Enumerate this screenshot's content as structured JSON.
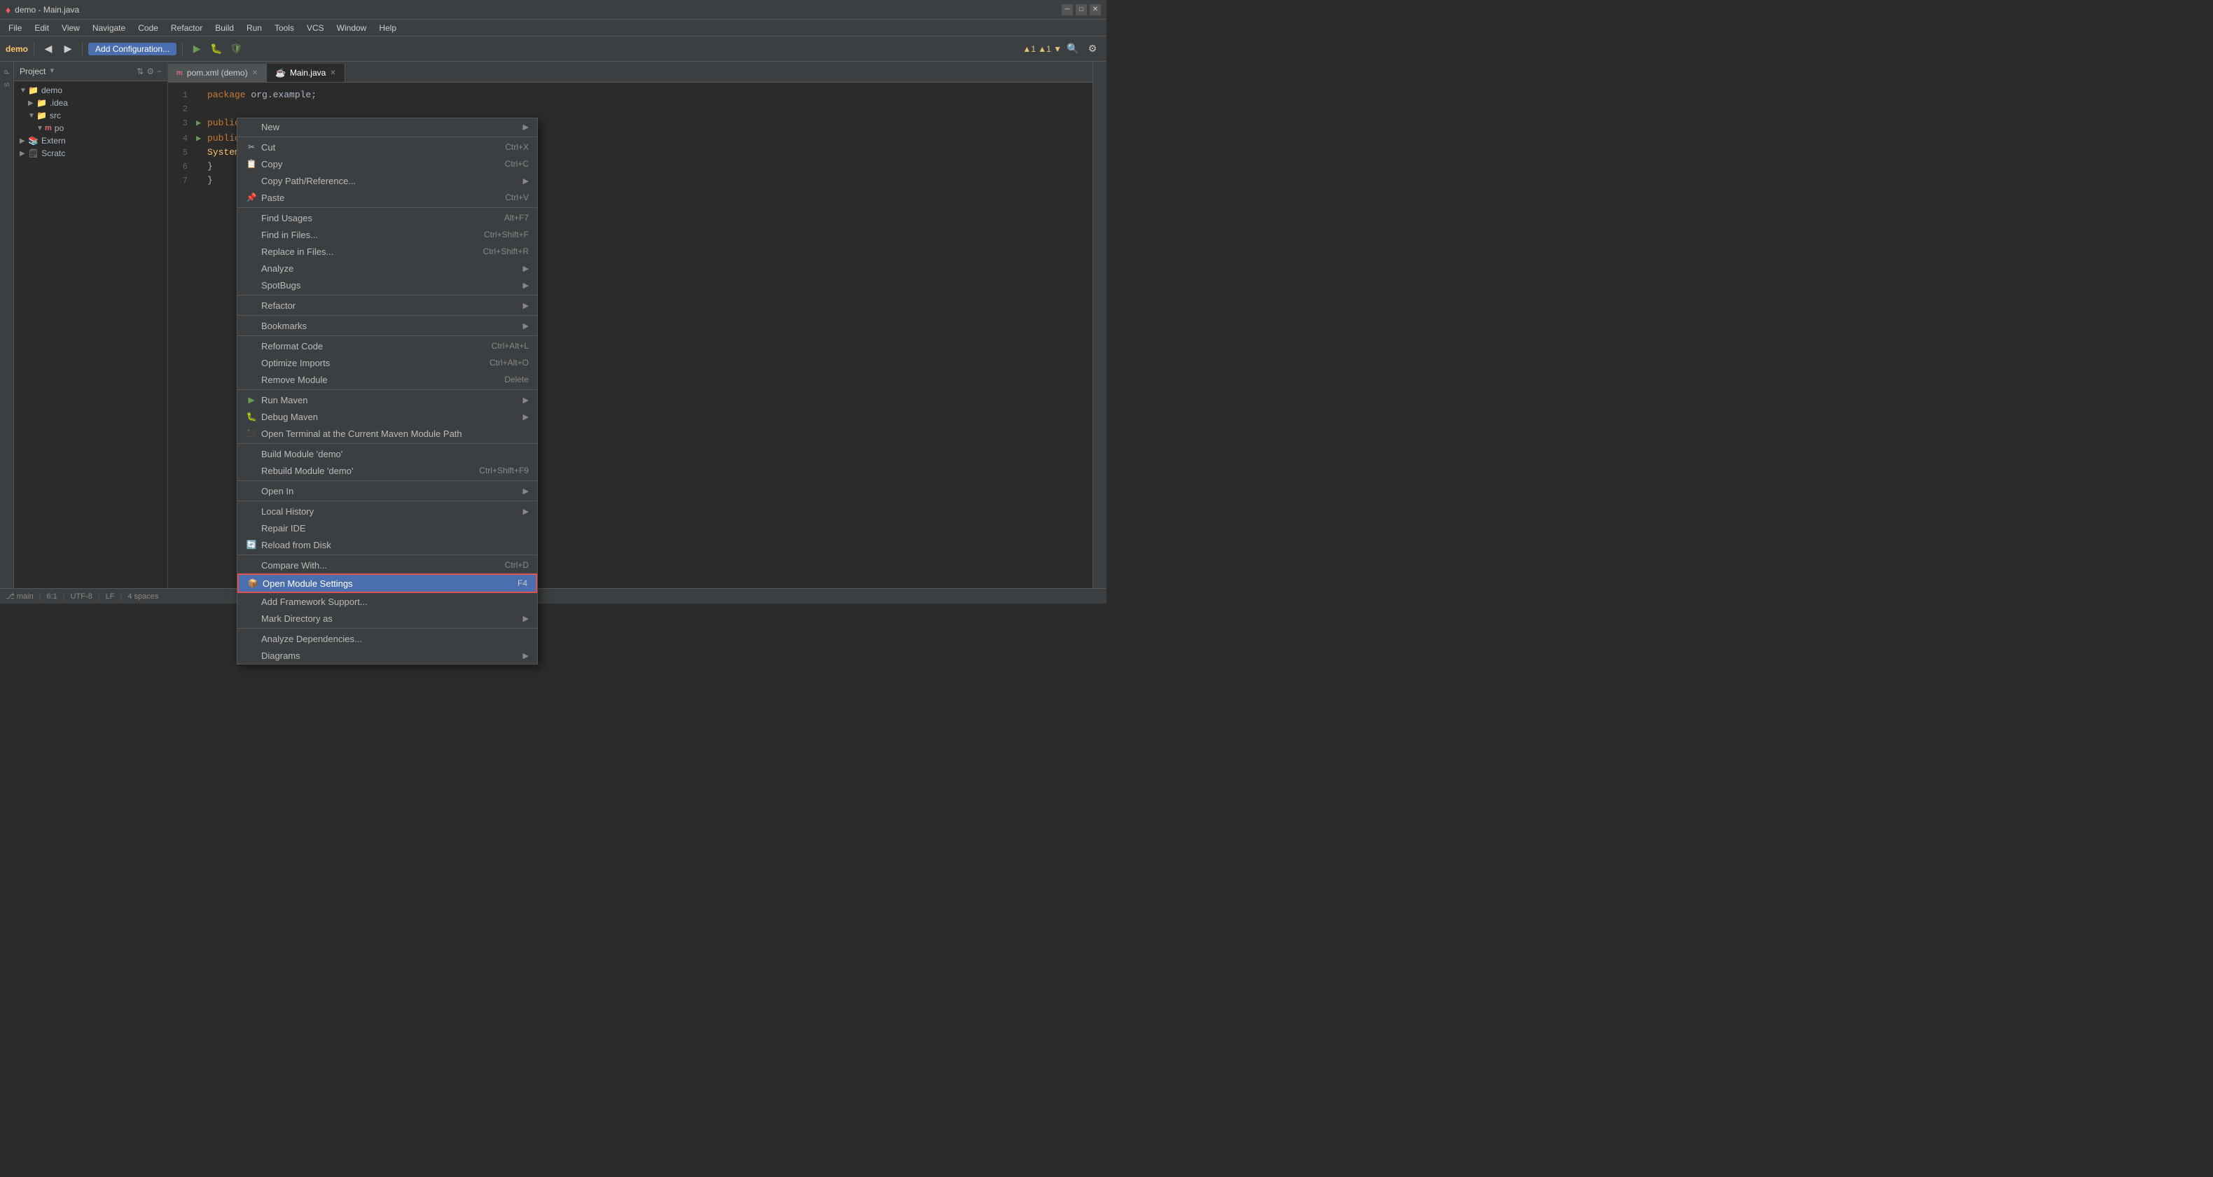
{
  "titlebar": {
    "logo": "♦",
    "title": "demo - Main.java",
    "minimize": "─",
    "maximize": "□",
    "close": "✕"
  },
  "menubar": {
    "items": [
      "File",
      "Edit",
      "View",
      "Navigate",
      "Code",
      "Refactor",
      "Build",
      "Run",
      "Tools",
      "VCS",
      "Window",
      "Help"
    ]
  },
  "toolbar": {
    "project_name": "demo",
    "add_config": "Add Configuration...",
    "icons": [
      "◀",
      "▶",
      "⟳",
      "⚙",
      "🔍",
      "⚡"
    ]
  },
  "project_panel": {
    "title": "Project",
    "tree": [
      {
        "label": "demo",
        "indent": 0,
        "expanded": true,
        "icon": "📁"
      },
      {
        "label": ".idea",
        "indent": 1,
        "expanded": false,
        "icon": "📁"
      },
      {
        "label": "src",
        "indent": 1,
        "expanded": true,
        "icon": "📁"
      },
      {
        "label": "po",
        "indent": 2,
        "expanded": false,
        "icon": "m"
      },
      {
        "label": "Extern",
        "indent": 0,
        "expanded": false,
        "icon": "📚"
      },
      {
        "label": "Scratc",
        "indent": 0,
        "expanded": false,
        "icon": "🗒"
      }
    ]
  },
  "tabs": [
    {
      "label": "pom.xml (demo)",
      "icon": "m",
      "active": false,
      "closeable": true
    },
    {
      "label": "Main.java",
      "icon": "☕",
      "active": true,
      "closeable": true
    }
  ],
  "editor": {
    "lines": [
      {
        "num": 1,
        "content": "package org.example;",
        "type": "plain"
      },
      {
        "num": 2,
        "content": "",
        "type": "plain"
      },
      {
        "num": 3,
        "content": "public class Main {",
        "type": "class"
      },
      {
        "num": 4,
        "content": "    public static void main(String[] args) {",
        "type": "method"
      },
      {
        "num": 5,
        "content": "        System.out.println(\"Hello world!\");",
        "type": "println"
      },
      {
        "num": 6,
        "content": "    }",
        "type": "plain"
      },
      {
        "num": 7,
        "content": "}",
        "type": "plain"
      }
    ]
  },
  "context_menu": {
    "items": [
      {
        "type": "submenu",
        "label": "New",
        "icon": ""
      },
      {
        "type": "separator"
      },
      {
        "type": "item",
        "label": "Cut",
        "shortcut": "Ctrl+X",
        "icon": "✂"
      },
      {
        "type": "item",
        "label": "Copy",
        "shortcut": "Ctrl+C",
        "icon": "📋"
      },
      {
        "type": "item",
        "label": "Copy Path/Reference...",
        "icon": ""
      },
      {
        "type": "item",
        "label": "Paste",
        "shortcut": "Ctrl+V",
        "icon": "📌"
      },
      {
        "type": "separator"
      },
      {
        "type": "item",
        "label": "Find Usages",
        "shortcut": "Alt+F7",
        "icon": ""
      },
      {
        "type": "item",
        "label": "Find in Files...",
        "shortcut": "Ctrl+Shift+F",
        "icon": ""
      },
      {
        "type": "item",
        "label": "Replace in Files...",
        "shortcut": "Ctrl+Shift+R",
        "icon": ""
      },
      {
        "type": "submenu",
        "label": "Analyze",
        "icon": ""
      },
      {
        "type": "submenu",
        "label": "SpotBugs",
        "icon": ""
      },
      {
        "type": "separator"
      },
      {
        "type": "submenu",
        "label": "Refactor",
        "icon": ""
      },
      {
        "type": "separator"
      },
      {
        "type": "submenu",
        "label": "Bookmarks",
        "icon": ""
      },
      {
        "type": "separator"
      },
      {
        "type": "item",
        "label": "Reformat Code",
        "shortcut": "Ctrl+Alt+L",
        "icon": ""
      },
      {
        "type": "item",
        "label": "Optimize Imports",
        "shortcut": "Ctrl+Alt+O",
        "icon": ""
      },
      {
        "type": "item",
        "label": "Remove Module",
        "shortcut": "Delete",
        "icon": ""
      },
      {
        "type": "separator"
      },
      {
        "type": "submenu",
        "label": "Run Maven",
        "icon": "▶"
      },
      {
        "type": "submenu",
        "label": "Debug Maven",
        "icon": "🐛"
      },
      {
        "type": "item",
        "label": "Open Terminal at the Current Maven Module Path",
        "icon": "⬛"
      },
      {
        "type": "separator"
      },
      {
        "type": "item",
        "label": "Build Module 'demo'",
        "icon": ""
      },
      {
        "type": "item",
        "label": "Rebuild Module 'demo'",
        "shortcut": "Ctrl+Shift+F9",
        "icon": ""
      },
      {
        "type": "separator"
      },
      {
        "type": "submenu",
        "label": "Open In",
        "icon": ""
      },
      {
        "type": "separator"
      },
      {
        "type": "submenu",
        "label": "Local History",
        "icon": ""
      },
      {
        "type": "item",
        "label": "Repair IDE",
        "icon": ""
      },
      {
        "type": "item",
        "label": "Reload from Disk",
        "icon": "🔄"
      },
      {
        "type": "separator"
      },
      {
        "type": "item",
        "label": "Compare With...",
        "shortcut": "Ctrl+D",
        "icon": ""
      },
      {
        "type": "item",
        "label": "Open Module Settings",
        "shortcut": "F4",
        "icon": "📦",
        "highlighted": true
      },
      {
        "type": "item",
        "label": "Add Framework Support...",
        "icon": ""
      },
      {
        "type": "submenu",
        "label": "Mark Directory as",
        "icon": ""
      },
      {
        "type": "separator"
      },
      {
        "type": "item",
        "label": "Analyze Dependencies...",
        "icon": ""
      },
      {
        "type": "submenu",
        "label": "Diagrams",
        "icon": ""
      }
    ]
  },
  "statusbar": {
    "line_col": "6:1",
    "encoding": "UTF-8",
    "line_sep": "LF",
    "indent": "4 spaces",
    "branch": "main"
  }
}
